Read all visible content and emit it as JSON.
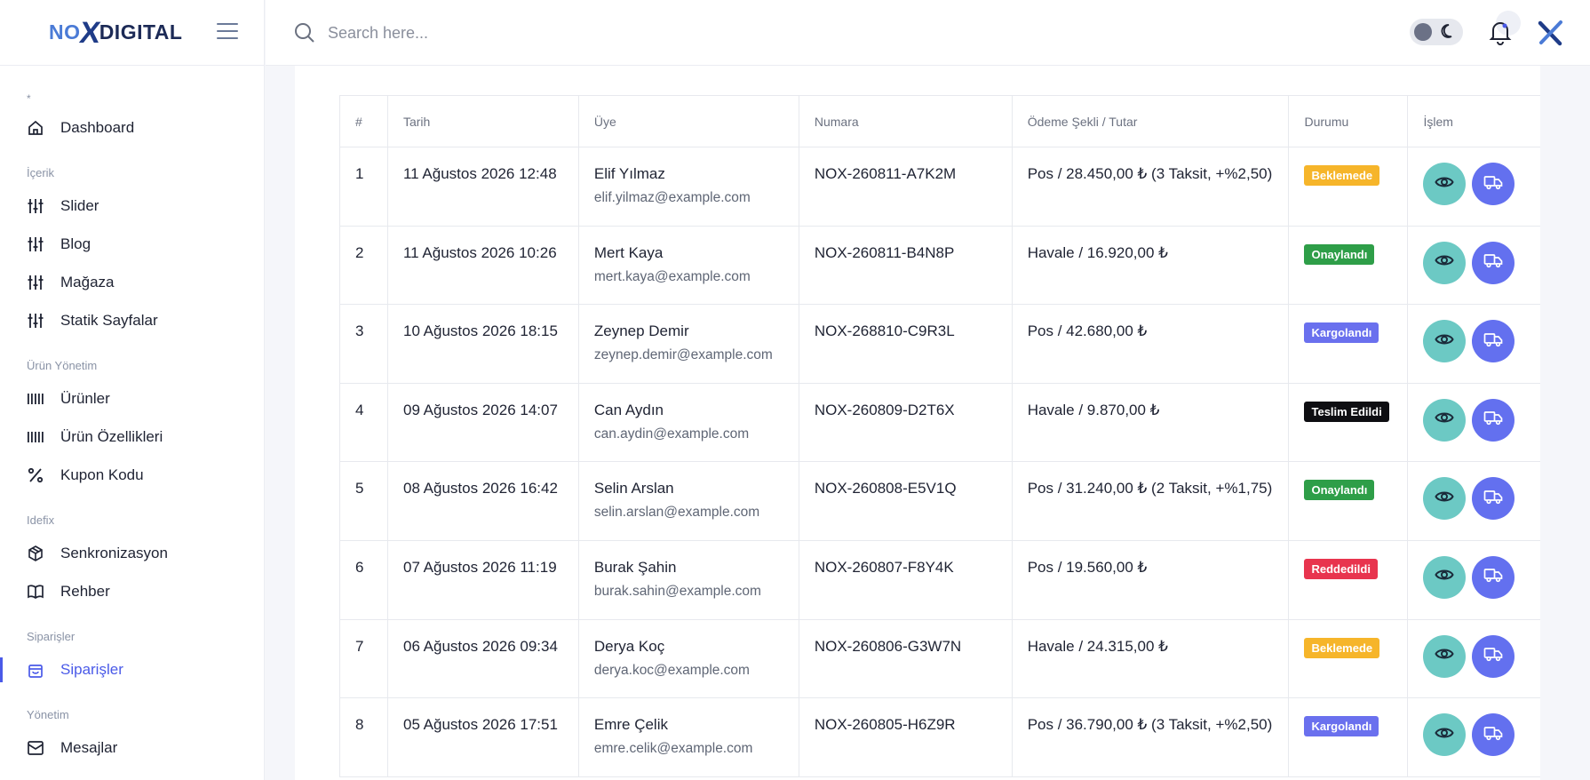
{
  "brand": {
    "logo_no": "NO",
    "logo_x": "X",
    "logo_digital": "DIGITAL"
  },
  "search": {
    "placeholder": "Search here..."
  },
  "sidebar": {
    "star": "*",
    "dashboard": "Dashboard",
    "sections": {
      "icerik": "İçerik",
      "urun": "Ürün Yönetim",
      "idefix": "Idefix",
      "siparisler": "Siparişler",
      "yonetim": "Yönetim"
    },
    "items": {
      "slider": "Slider",
      "blog": "Blog",
      "magaza": "Mağaza",
      "statik": "Statik Sayfalar",
      "urunler": "Ürünler",
      "urun_ozellikleri": "Ürün Özellikleri",
      "kupon": "Kupon Kodu",
      "senkronizasyon": "Senkronizasyon",
      "rehber": "Rehber",
      "siparisler": "Siparişler",
      "mesajlar": "Mesajlar"
    }
  },
  "table": {
    "headers": [
      "#",
      "Tarih",
      "Üye",
      "Numara",
      "Ödeme Şekli / Tutar",
      "Durumu",
      "İşlem"
    ],
    "rows": [
      {
        "no": "1",
        "date": "11 Ağustos 2026 12:48",
        "name": "Elif Yılmaz",
        "email": "elif.yilmaz@example.com",
        "number": "NOX-260811-A7K2M",
        "payment": "Pos / 28.450,00 ₺ (3 Taksit, +%2,50)",
        "status": "Beklemede",
        "status_color": "#f6b52a"
      },
      {
        "no": "2",
        "date": "11 Ağustos 2026 10:26",
        "name": "Mert Kaya",
        "email": "mert.kaya@example.com",
        "number": "NOX-260811-B4N8P",
        "payment": "Havale / 16.920,00 ₺",
        "status": "Onaylandı",
        "status_color": "#2e9e48"
      },
      {
        "no": "3",
        "date": "10 Ağustos 2026 18:15",
        "name": "Zeynep Demir",
        "email": "zeynep.demir@example.com",
        "number": "NOX-268810-C9R3L",
        "payment": "Pos / 42.680,00 ₺",
        "status": "Kargolandı",
        "status_color": "#6a70ee"
      },
      {
        "no": "4",
        "date": "09 Ağustos 2026 14:07",
        "name": "Can Aydın",
        "email": "can.aydin@example.com",
        "number": "NOX-260809-D2T6X",
        "payment": "Havale / 9.870,00 ₺",
        "status": "Teslim Edildi",
        "status_color": "#0e0e12"
      },
      {
        "no": "5",
        "date": "08 Ağustos 2026 16:42",
        "name": "Selin Arslan",
        "email": "selin.arslan@example.com",
        "number": "NOX-260808-E5V1Q",
        "payment": "Pos / 31.240,00 ₺ (2 Taksit, +%1,75)",
        "status": "Onaylandı",
        "status_color": "#2e9e48"
      },
      {
        "no": "6",
        "date": "07 Ağustos 2026 11:19",
        "name": "Burak Şahin",
        "email": "burak.sahin@example.com",
        "number": "NOX-260807-F8Y4K",
        "payment": "Pos / 19.560,00 ₺",
        "status": "Reddedildi",
        "status_color": "#e8344e"
      },
      {
        "no": "7",
        "date": "06 Ağustos 2026 09:34",
        "name": "Derya Koç",
        "email": "derya.koc@example.com",
        "number": "NOX-260806-G3W7N",
        "payment": "Havale / 24.315,00 ₺",
        "status": "Beklemede",
        "status_color": "#f6b52a"
      },
      {
        "no": "8",
        "date": "05 Ağustos 2026 17:51",
        "name": "Emre Çelik",
        "email": "emre.celik@example.com",
        "number": "NOX-260805-H6Z9R",
        "payment": "Pos / 36.790,00 ₺ (3 Taksit, +%2,50)",
        "status": "Kargolandı",
        "status_color": "#6a70ee"
      }
    ]
  },
  "icons": {
    "view": "eye-icon",
    "ship": "truck-icon",
    "search": "search-icon",
    "notifications": "bell-icon",
    "theme": "moon-icon"
  },
  "colors": {
    "accent": "#4a5ae8",
    "view_button": "#6cc9c4",
    "ship_button": "#6370ef"
  }
}
